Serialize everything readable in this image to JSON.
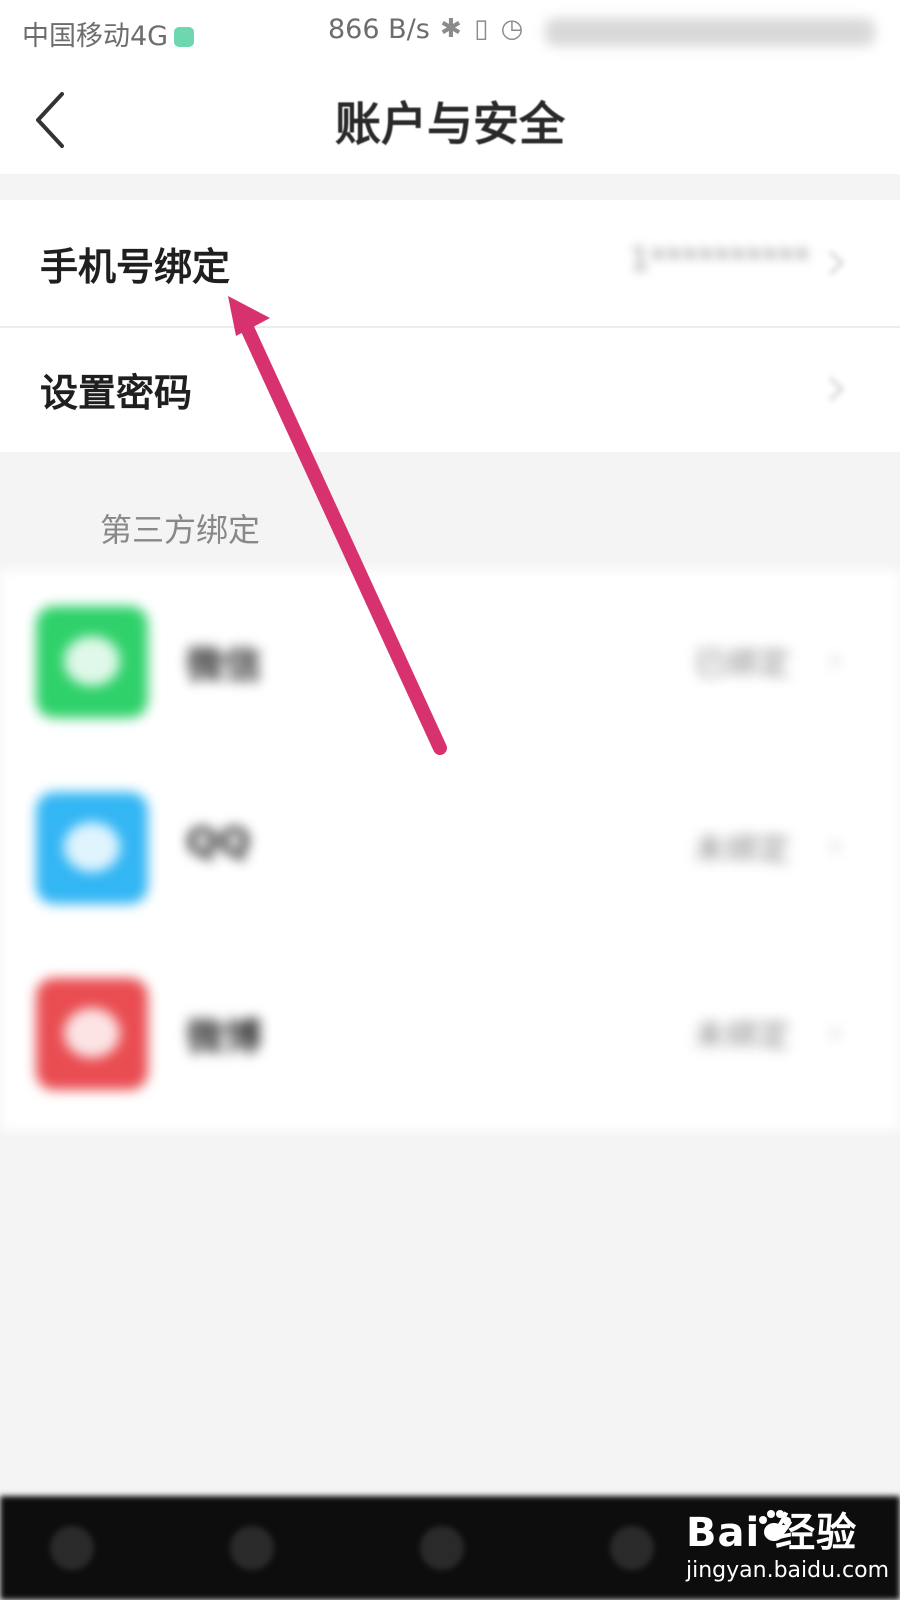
{
  "status_bar": {
    "carrier": "中国移动4G",
    "net_speed": "866 B/s",
    "icons": [
      "bluetooth-icon",
      "vibrate-icon",
      "alarm-icon"
    ]
  },
  "header": {
    "title": "账户与安全",
    "back_icon": "back-chevron-icon"
  },
  "account_settings": {
    "items": [
      {
        "label": "手机号绑定",
        "value": "1**********"
      },
      {
        "label": "设置密码",
        "value": ""
      }
    ]
  },
  "third_party": {
    "header": "第三方绑定",
    "items": [
      {
        "name": "微信",
        "status": "已绑定",
        "icon": "wechat-icon",
        "color": "#2fd16a"
      },
      {
        "name": "QQ",
        "status": "未绑定",
        "icon": "qq-icon",
        "color": "#33b6f4"
      },
      {
        "name": "微博",
        "status": "未绑定",
        "icon": "weibo-icon",
        "color": "#e94d52"
      }
    ]
  },
  "annotation": {
    "arrow_color": "#d8316f"
  },
  "watermark": {
    "logo": "Bai  经验",
    "url": "jingyan.baidu.com"
  }
}
